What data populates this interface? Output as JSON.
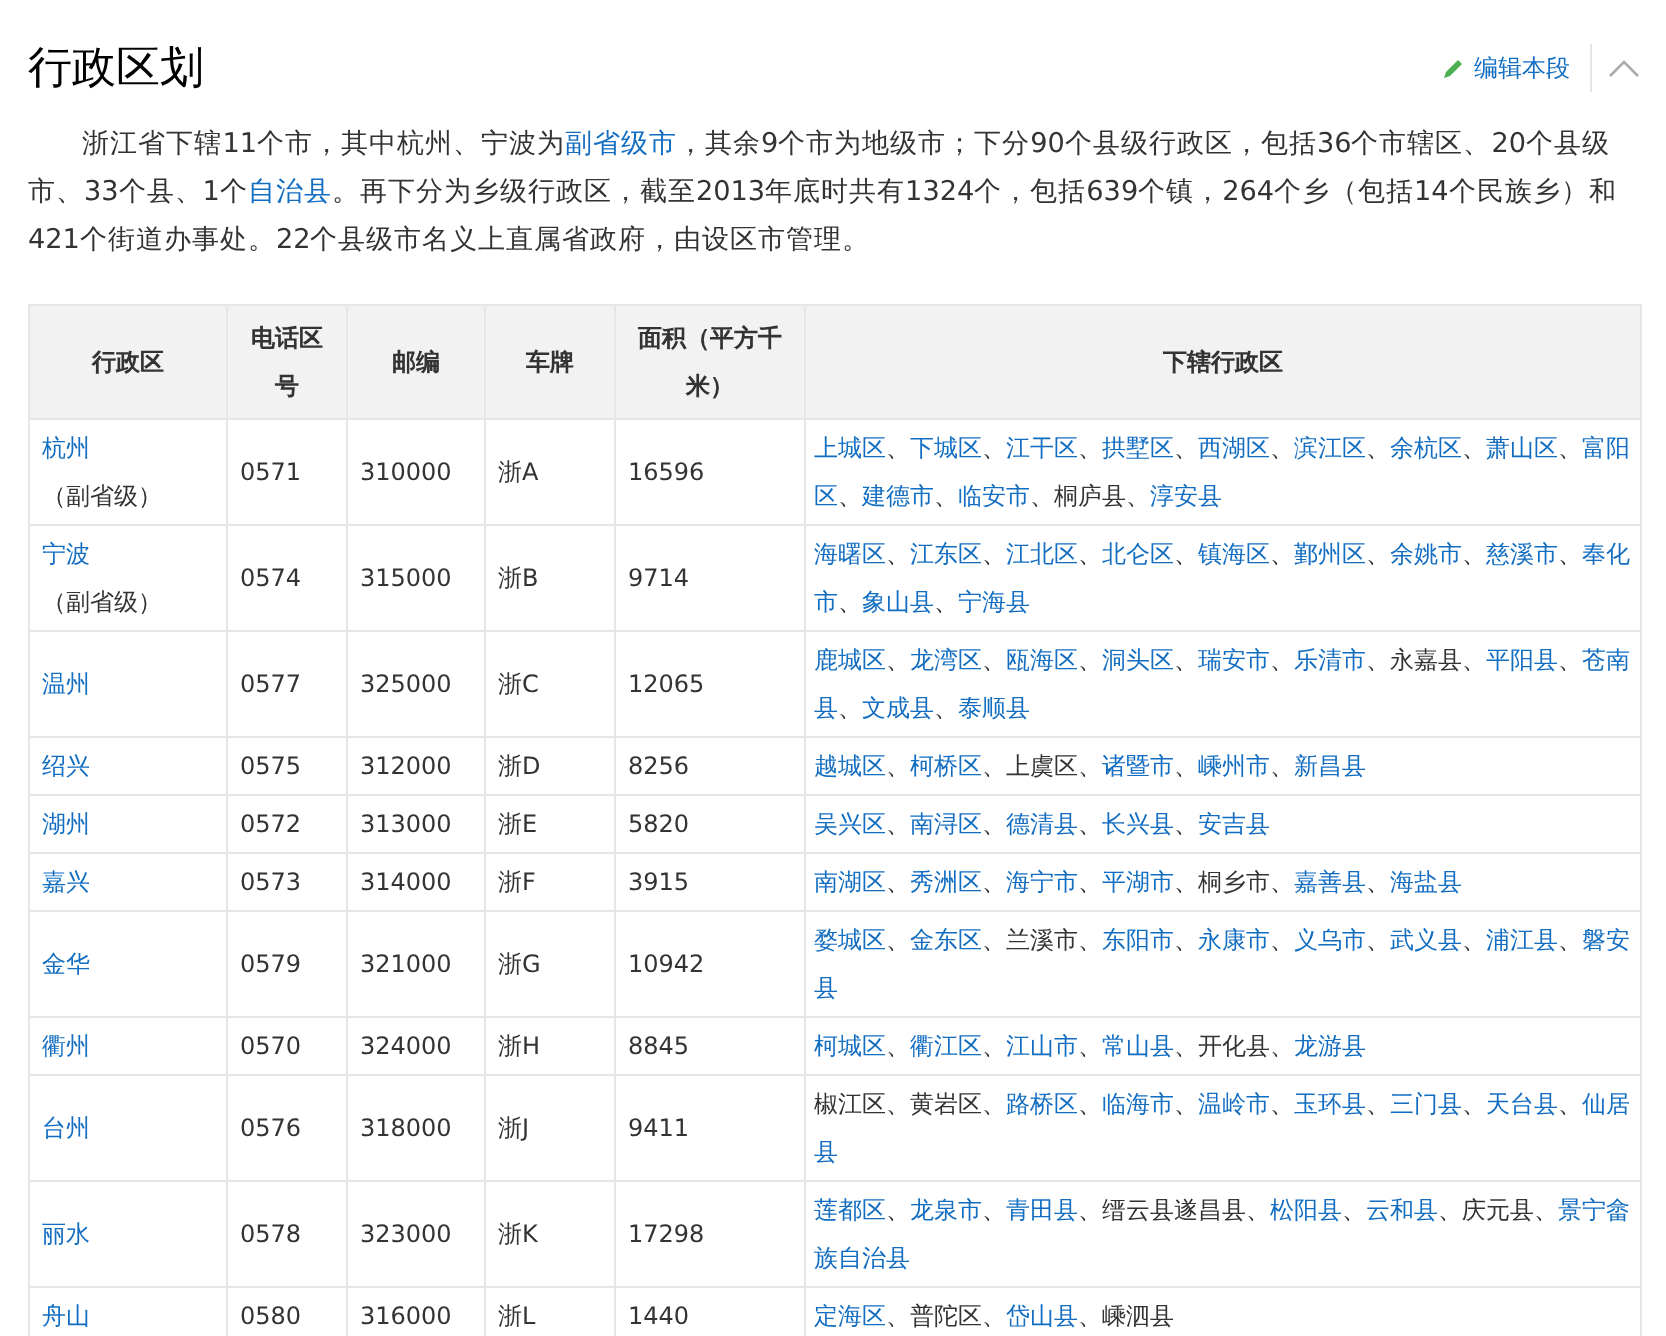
{
  "section": {
    "title": "行政区划",
    "edit_label": "编辑本段"
  },
  "intro": [
    {
      "text": "浙江省下辖11个市，其中杭州、宁波为",
      "link": false
    },
    {
      "text": "副省级市",
      "link": true
    },
    {
      "text": "，其余9个市为地级市；下分90个县级行政区，包括36个市辖区、20个县级市、33个县、1个",
      "link": false
    },
    {
      "text": "自治县",
      "link": true
    },
    {
      "text": "。再下分为乡级行政区，截至2013年底时共有1324个，包括639个镇，264个乡（包括14个民族乡）和421个街道办事处。22个县级市名义上直属省政府，由设区市管理。",
      "link": false
    }
  ],
  "table": {
    "columns": [
      "行政区",
      "电话区号",
      "邮编",
      "车牌",
      "面积（平方千米）",
      "下辖行政区"
    ],
    "separator": "、",
    "rows": [
      {
        "city": "杭州",
        "note": "（副省级）",
        "area_code": "0571",
        "postcode": "310000",
        "plate": "浙A",
        "area": "16596",
        "subdivisions": [
          {
            "text": "上城区",
            "link": true
          },
          {
            "text": "下城区",
            "link": true
          },
          {
            "text": "江干区",
            "link": true
          },
          {
            "text": "拱墅区",
            "link": true
          },
          {
            "text": "西湖区",
            "link": true
          },
          {
            "text": "滨江区",
            "link": true
          },
          {
            "text": "余杭区",
            "link": true
          },
          {
            "text": "萧山区",
            "link": true
          },
          {
            "text": "富阳区",
            "link": true
          },
          {
            "text": "建德市",
            "link": true
          },
          {
            "text": "临安市",
            "link": true
          },
          {
            "text": "桐庐县",
            "link": false
          },
          {
            "text": "淳安县",
            "link": true
          }
        ]
      },
      {
        "city": "宁波",
        "note": "（副省级）",
        "area_code": "0574",
        "postcode": "315000",
        "plate": "浙B",
        "area": "9714",
        "subdivisions": [
          {
            "text": "海曙区",
            "link": true
          },
          {
            "text": "江东区",
            "link": true
          },
          {
            "text": "江北区",
            "link": true
          },
          {
            "text": "北仑区",
            "link": true
          },
          {
            "text": "镇海区",
            "link": true
          },
          {
            "text": "鄞州区",
            "link": true
          },
          {
            "text": "余姚市",
            "link": true
          },
          {
            "text": "慈溪市",
            "link": true
          },
          {
            "text": "奉化市",
            "link": true
          },
          {
            "text": "象山县",
            "link": true
          },
          {
            "text": "宁海县",
            "link": true
          }
        ]
      },
      {
        "city": "温州",
        "area_code": "0577",
        "postcode": "325000",
        "plate": "浙C",
        "area": "12065",
        "subdivisions": [
          {
            "text": "鹿城区",
            "link": true
          },
          {
            "text": "龙湾区",
            "link": true
          },
          {
            "text": "瓯海区",
            "link": true
          },
          {
            "text": "洞头区",
            "link": true
          },
          {
            "text": "瑞安市",
            "link": true
          },
          {
            "text": "乐清市",
            "link": true
          },
          {
            "text": "永嘉县",
            "link": false
          },
          {
            "text": "平阳县",
            "link": true
          },
          {
            "text": "苍南县",
            "link": true
          },
          {
            "text": "文成县",
            "link": true
          },
          {
            "text": "泰顺县",
            "link": true
          }
        ]
      },
      {
        "city": "绍兴",
        "area_code": "0575",
        "postcode": "312000",
        "plate": "浙D",
        "area": "8256",
        "subdivisions": [
          {
            "text": "越城区",
            "link": true
          },
          {
            "text": "柯桥区",
            "link": true
          },
          {
            "text": "上虞区",
            "link": false
          },
          {
            "text": "诸暨市",
            "link": true
          },
          {
            "text": "嵊州市",
            "link": true
          },
          {
            "text": "新昌县",
            "link": true
          }
        ]
      },
      {
        "city": "湖州",
        "area_code": "0572",
        "postcode": "313000",
        "plate": "浙E",
        "area": "5820",
        "subdivisions": [
          {
            "text": "吴兴区",
            "link": true
          },
          {
            "text": "南浔区",
            "link": true
          },
          {
            "text": "德清县",
            "link": true
          },
          {
            "text": "长兴县",
            "link": true
          },
          {
            "text": "安吉县",
            "link": true
          }
        ]
      },
      {
        "city": "嘉兴",
        "area_code": "0573",
        "postcode": "314000",
        "plate": "浙F",
        "area": "3915",
        "subdivisions": [
          {
            "text": "南湖区",
            "link": true
          },
          {
            "text": "秀洲区",
            "link": true
          },
          {
            "text": "海宁市",
            "link": true
          },
          {
            "text": "平湖市",
            "link": true
          },
          {
            "text": "桐乡市",
            "link": false
          },
          {
            "text": "嘉善县",
            "link": true
          },
          {
            "text": "海盐县",
            "link": true
          }
        ]
      },
      {
        "city": "金华",
        "area_code": "0579",
        "postcode": "321000",
        "plate": "浙G",
        "area": "10942",
        "subdivisions": [
          {
            "text": "婺城区",
            "link": true
          },
          {
            "text": "金东区",
            "link": true
          },
          {
            "text": "兰溪市",
            "link": false
          },
          {
            "text": "东阳市",
            "link": true
          },
          {
            "text": "永康市",
            "link": true
          },
          {
            "text": "义乌市",
            "link": true
          },
          {
            "text": "武义县",
            "link": true
          },
          {
            "text": "浦江县",
            "link": true
          },
          {
            "text": "磐安县",
            "link": true
          }
        ]
      },
      {
        "city": "衢州",
        "area_code": "0570",
        "postcode": "324000",
        "plate": "浙H",
        "area": "8845",
        "subdivisions": [
          {
            "text": "柯城区",
            "link": true
          },
          {
            "text": "衢江区",
            "link": true
          },
          {
            "text": "江山市",
            "link": true
          },
          {
            "text": "常山县",
            "link": true
          },
          {
            "text": "开化县",
            "link": false
          },
          {
            "text": "龙游县",
            "link": true
          }
        ]
      },
      {
        "city": "台州",
        "area_code": "0576",
        "postcode": "318000",
        "plate": "浙J",
        "area": "9411",
        "subdivisions": [
          {
            "text": "椒江区",
            "link": false
          },
          {
            "text": "黄岩区",
            "link": false
          },
          {
            "text": "路桥区",
            "link": true
          },
          {
            "text": "临海市",
            "link": true
          },
          {
            "text": "温岭市",
            "link": true
          },
          {
            "text": "玉环县",
            "link": true
          },
          {
            "text": "三门县",
            "link": true
          },
          {
            "text": "天台县",
            "link": true
          },
          {
            "text": "仙居县",
            "link": true
          }
        ]
      },
      {
        "city": "丽水",
        "area_code": "0578",
        "postcode": "323000",
        "plate": "浙K",
        "area": "17298",
        "subdivisions": [
          {
            "text": "莲都区",
            "link": true
          },
          {
            "text": "龙泉市",
            "link": true
          },
          {
            "text": "青田县",
            "link": true
          },
          {
            "text": "缙云县遂昌县",
            "link": false
          },
          {
            "text": "松阳县",
            "link": true
          },
          {
            "text": "云和县",
            "link": true
          },
          {
            "text": "庆元县",
            "link": false
          },
          {
            "text": "景宁畲族自治县",
            "link": true
          }
        ]
      },
      {
        "city": "舟山",
        "area_code": "0580",
        "postcode": "316000",
        "plate": "浙L",
        "area": "1440",
        "subdivisions": [
          {
            "text": "定海区",
            "link": true
          },
          {
            "text": "普陀区",
            "link": false
          },
          {
            "text": "岱山县",
            "link": true
          },
          {
            "text": "嵊泗县",
            "link": false
          }
        ]
      }
    ]
  }
}
